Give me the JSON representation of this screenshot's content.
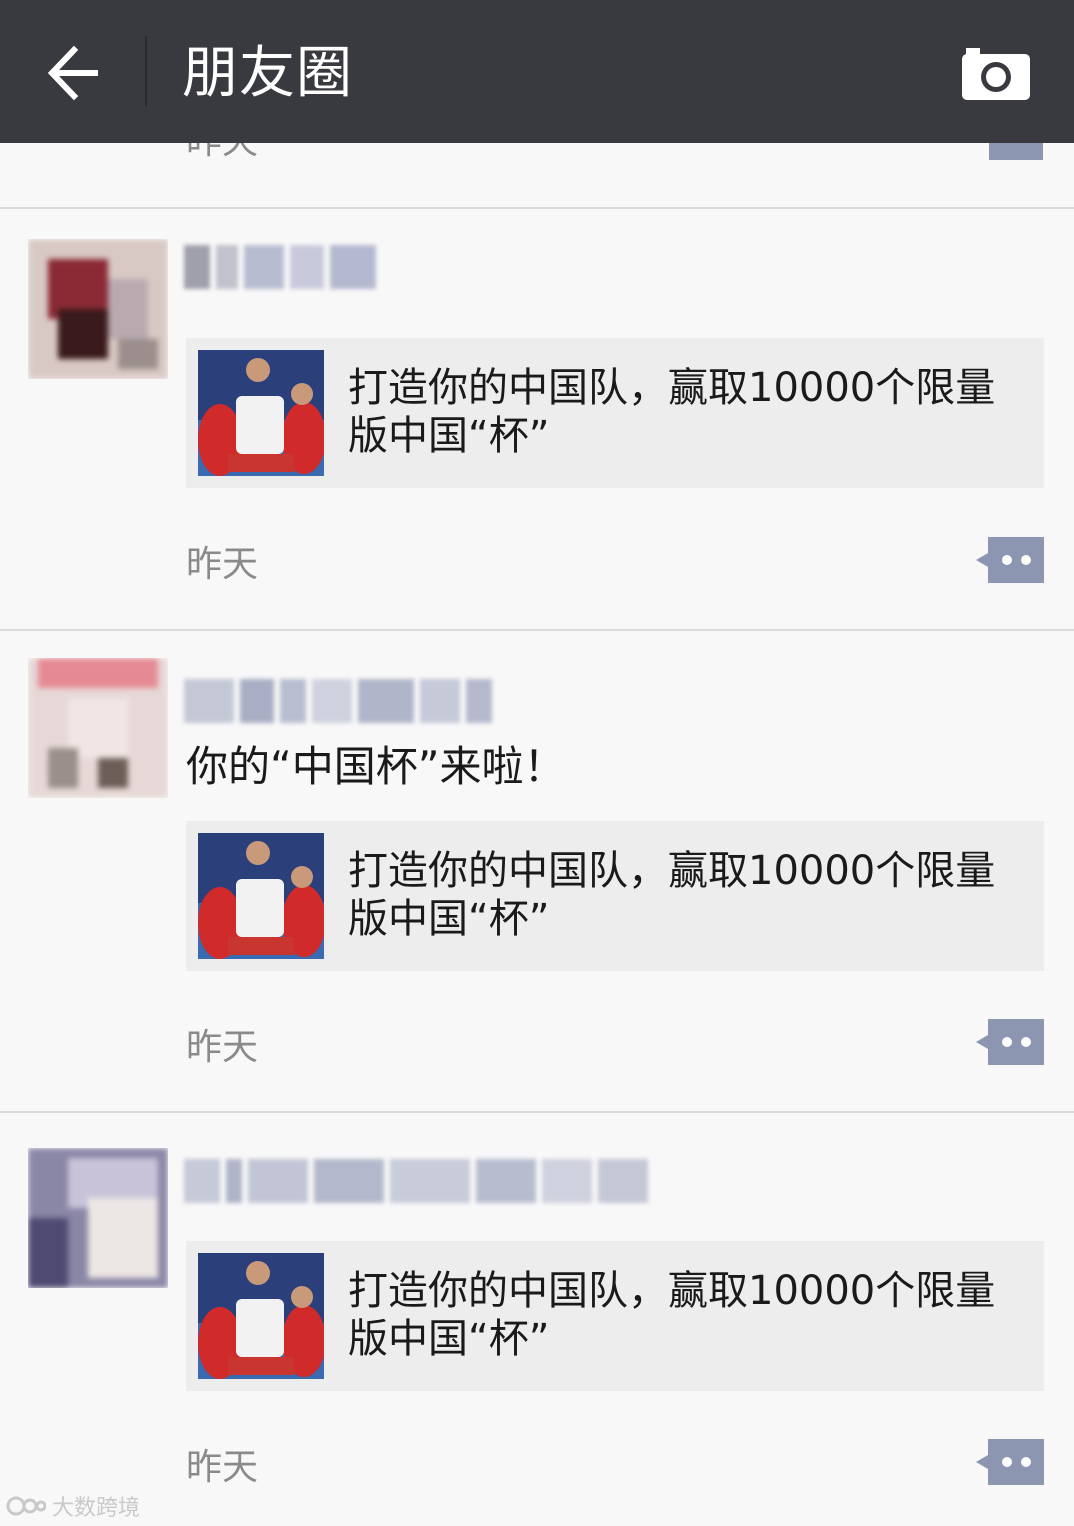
{
  "header": {
    "title": "朋友圈",
    "back_icon": "arrow-left-icon",
    "camera_icon": "camera-icon"
  },
  "partial_post": {
    "time": "昨天"
  },
  "posts": [
    {
      "text": "",
      "link": {
        "title": "打造你的中国队，赢取10000个限量版中国“杯”"
      },
      "time": "昨天"
    },
    {
      "text": "你的“中国杯”来啦！",
      "link": {
        "title": "打造你的中国队，赢取10000个限量版中国“杯”"
      },
      "time": "昨天"
    },
    {
      "text": "",
      "link": {
        "title": "打造你的中国队，赢取10000个限量版中国“杯”"
      },
      "time": "昨天"
    }
  ],
  "watermark": "大数跨境",
  "colors": {
    "header_bg": "#393a3f",
    "comment_icon": "#8c96b0",
    "time_text": "#8a8a8a"
  }
}
